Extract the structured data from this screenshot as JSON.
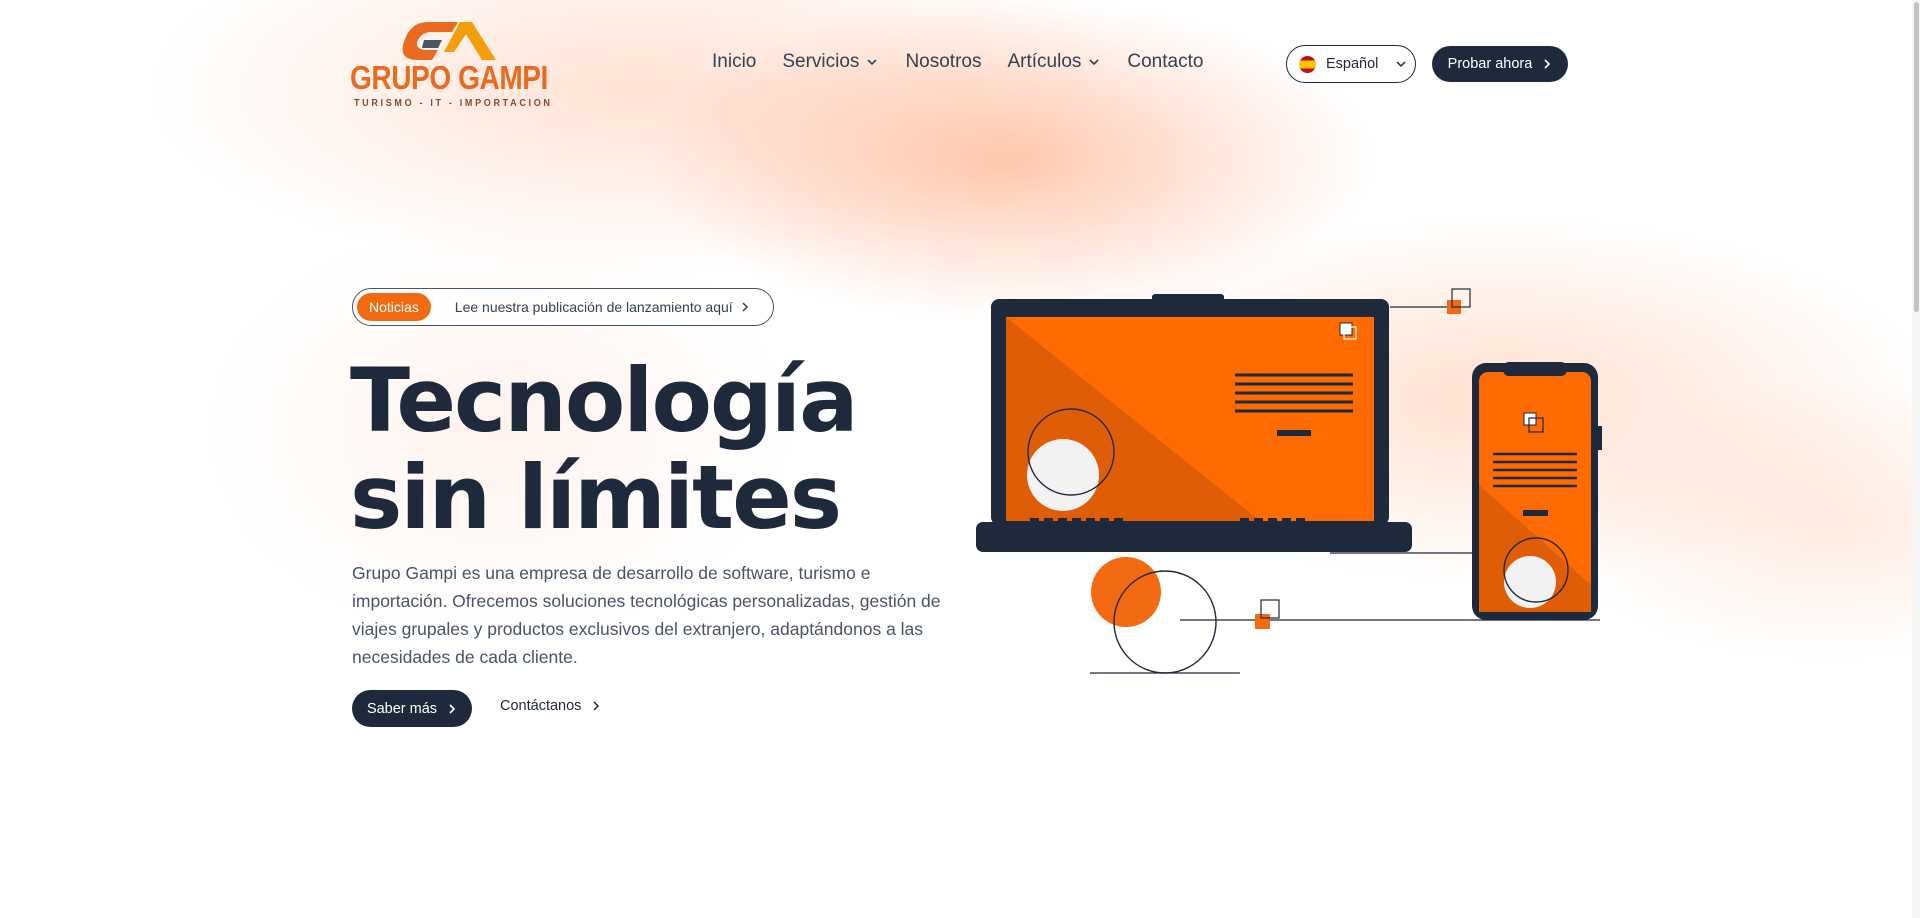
{
  "brand": {
    "name": "GRUPO GAMPI",
    "tagline": "TURISMO - IT - IMPORTACION",
    "accent_color": "#f26b12",
    "dark_color": "#1e293b"
  },
  "nav": {
    "items": [
      {
        "label": "Inicio",
        "has_dropdown": false
      },
      {
        "label": "Servicios",
        "has_dropdown": true
      },
      {
        "label": "Nosotros",
        "has_dropdown": false
      },
      {
        "label": "Artículos",
        "has_dropdown": true
      },
      {
        "label": "Contacto",
        "has_dropdown": false
      }
    ]
  },
  "language": {
    "selected": "Español",
    "flag_icon": "spain-flag-icon"
  },
  "header_cta": {
    "label": "Probar ahora"
  },
  "news": {
    "badge": "Noticias",
    "text": "Lee nuestra publicación de lanzamiento aquí"
  },
  "hero": {
    "title_line1": "Tecnología",
    "title_line2": "sin límites",
    "description": "Grupo Gampi es una empresa de desarrollo de software, turismo e importación. Ofrecemos soluciones tecnológicas personalizadas, gestión de viajes grupales y productos exclusivos del extranjero, adaptándonos a las necesidades de cada cliente.",
    "primary_button": "Saber más",
    "secondary_link": "Contáctanos"
  }
}
